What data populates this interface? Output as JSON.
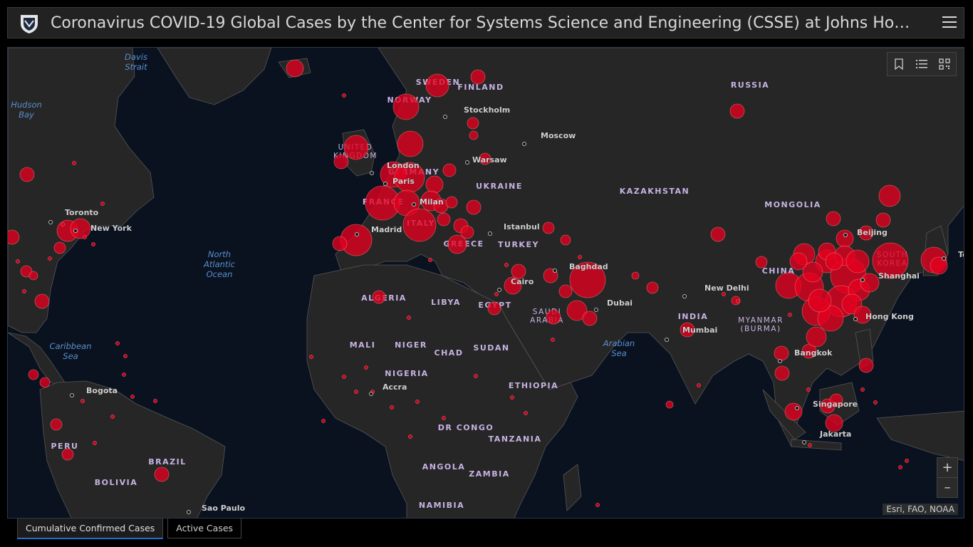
{
  "header": {
    "title": "Coronavirus COVID-19 Global Cases by the Center for Systems Science and Engineering (CSSE) at Johns Hopkins University",
    "logo_icon": "shield-logo-icon",
    "menu_icon": "hamburger-menu-icon"
  },
  "map": {
    "tools": [
      "bookmark-icon",
      "list-icon",
      "qr-code-icon"
    ],
    "zoom_in": "+",
    "zoom_out": "–",
    "attribution": "Esri, FAO, NOAA",
    "colors": {
      "ocean": "#0a1220",
      "land": "#262626",
      "border": "#555555",
      "circle_fill": "#e4001f",
      "country_label": "#c7b2e2",
      "water_label": "#5a8fcc",
      "city_label": "#cfcfcf"
    },
    "countries": [
      "RUSSIA",
      "SWEDEN",
      "FINLAND",
      "NORWAY",
      "UNITED KINGDOM",
      "GERMANY",
      "FRANCE",
      "ITALY",
      "UKRAINE",
      "KAZAKHSTAN",
      "MONGOLIA",
      "CHINA",
      "SOUTH KOREA",
      "TURKEY",
      "GREECE",
      "ALGERIA",
      "LIBYA",
      "EGYPT",
      "SAUDI ARABIA",
      "INDIA",
      "MYANMAR (BURMA)",
      "MALI",
      "NIGER",
      "CHAD",
      "SUDAN",
      "NIGERIA",
      "ETHIOPIA",
      "DR CONGO",
      "TANZANIA",
      "ANGOLA",
      "ZAMBIA",
      "NAMIBIA",
      "BRAZIL",
      "PERU",
      "BOLIVIA"
    ],
    "water_bodies": [
      "Davis Strait",
      "Hudson Bay",
      "North Atlantic Ocean",
      "Caribbean Sea",
      "Arabian Sea"
    ],
    "cities": [
      "Moscow",
      "Stockholm",
      "Warsaw",
      "London",
      "Paris",
      "Milan",
      "Madrid",
      "Istanbul",
      "Toronto",
      "New York",
      "Baghdad",
      "Cairo",
      "Dubai",
      "New Delhi",
      "Mumbai",
      "Beijing",
      "Shanghai",
      "Hong Kong",
      "Tokyo",
      "Bangkok",
      "Singapore",
      "Jakarta",
      "Bogota",
      "Accra",
      "Sao Paulo"
    ]
  },
  "tabs": [
    "Cumulative Confirmed Cases",
    "Active Cases"
  ]
}
